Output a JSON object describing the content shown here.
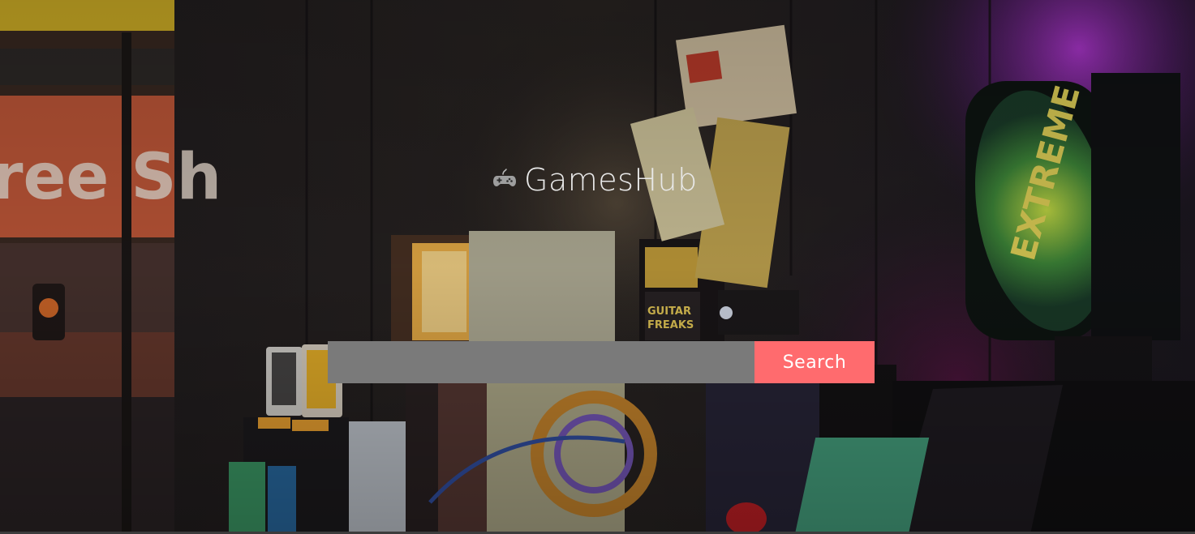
{
  "brand": {
    "title": "GamesHub",
    "icon": "gamepad-icon"
  },
  "search": {
    "value": "",
    "placeholder": "",
    "button_label": "Search"
  },
  "background": {
    "image": "arcade-machines-photo"
  },
  "colors": {
    "search_button": "#ff6b6e",
    "search_input": "#7a7a7a",
    "title_text": "#e8e8e8"
  }
}
